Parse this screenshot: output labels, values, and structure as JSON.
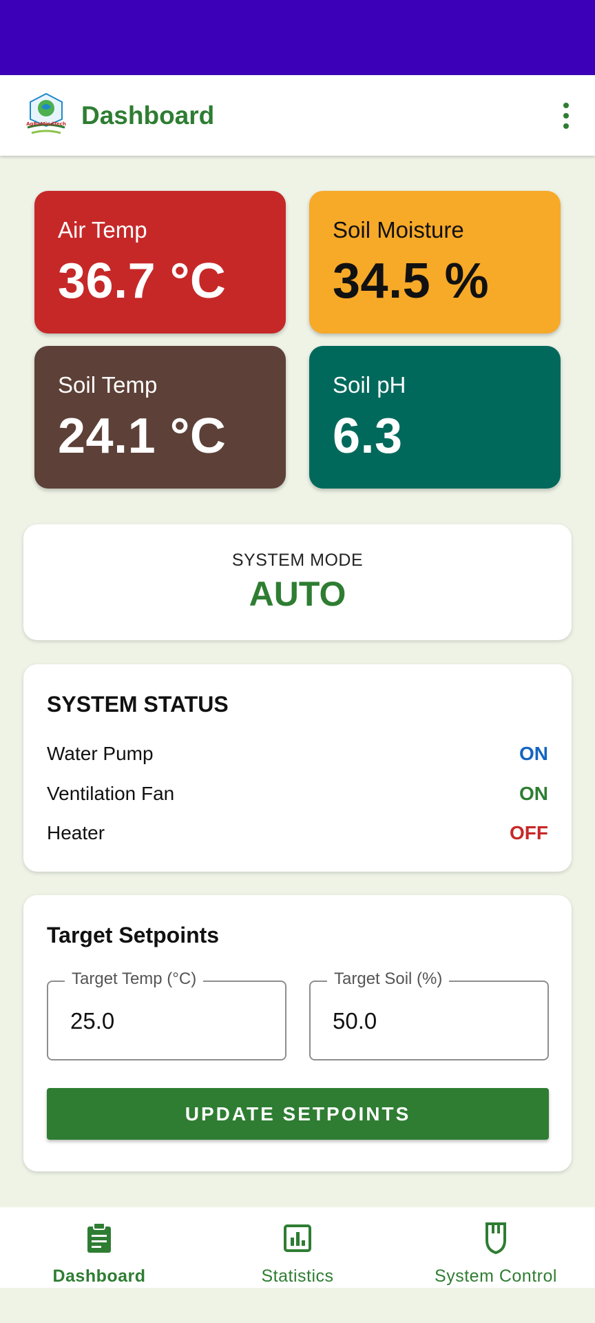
{
  "app_bar": {
    "title": "Dashboard",
    "logo_text": "AgRoMindTech"
  },
  "sensors": {
    "air_temp": {
      "label": "Air Temp",
      "value": "36.7 °C"
    },
    "soil_moisture": {
      "label": "Soil Moisture",
      "value": "34.5 %"
    },
    "soil_temp": {
      "label": "Soil Temp",
      "value": "24.1 °C"
    },
    "soil_ph": {
      "label": "Soil pH",
      "value": "6.3"
    }
  },
  "system_mode": {
    "caption": "SYSTEM MODE",
    "value": "AUTO"
  },
  "system_status": {
    "title": "SYSTEM STATUS",
    "items": [
      {
        "name": "Water Pump",
        "value": "ON",
        "color": "#1565c0"
      },
      {
        "name": "Ventilation Fan",
        "value": "ON",
        "color": "#2e7d32"
      },
      {
        "name": "Heater",
        "value": "OFF",
        "color": "#c62828"
      }
    ]
  },
  "setpoints": {
    "title": "Target Setpoints",
    "temp": {
      "label": "Target Temp (°C)",
      "value": "25.0"
    },
    "soil": {
      "label": "Target Soil (%)",
      "value": "50.0"
    },
    "button_label": "UPDATE SETPOINTS"
  },
  "bottom_nav": [
    {
      "label": "Dashboard",
      "icon": "clipboard-icon",
      "active": true
    },
    {
      "label": "Statistics",
      "icon": "chart-icon",
      "active": false
    },
    {
      "label": "System Control",
      "icon": "plug-icon",
      "active": false
    }
  ],
  "colors": {
    "primary": "#2e7d32",
    "status_bar": "#3b00b8",
    "background": "#eef3e6"
  }
}
